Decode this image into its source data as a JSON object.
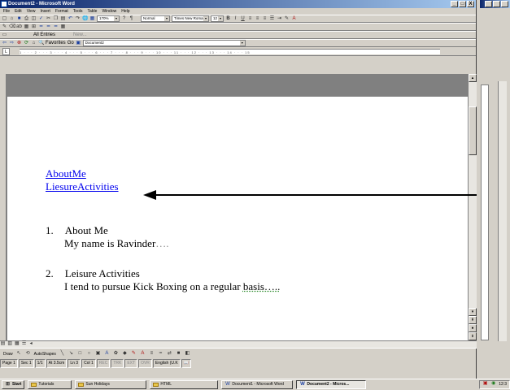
{
  "window": {
    "title": "Document2 - Microsoft Word",
    "buttons": [
      "_",
      "□",
      "X"
    ]
  },
  "menu": [
    "File",
    "Edit",
    "View",
    "Insert",
    "Format",
    "Tools",
    "Table",
    "Window",
    "Help"
  ],
  "toolbar": {
    "zoom": "170%",
    "style": "Normal",
    "font": "Times New Roman",
    "size": "12",
    "autotext": "All Entries",
    "new_label": "New...",
    "favorites": "Favorites",
    "go": "Go",
    "address": "Document2"
  },
  "ruler": {
    "numbers": "1 · · · 2 · · · 3 · · · 4 · · · 5 · · · 6 · · · 7 · · · 8 · · · 9 · · · 10 · · · 11 · · · 12 · · · 13 · · · 14 · · · 15"
  },
  "document": {
    "links": [
      "AboutMe",
      "LiesureActivities"
    ],
    "list": [
      {
        "num": "1.",
        "heading": "About Me",
        "body": "My name is Ravinder",
        "trail": "…."
      },
      {
        "num": "2.",
        "heading": "Leisure Activities",
        "body": "I tend to pursue Kick Boxing on a regular ",
        "underlined": "basis",
        "trail": "….."
      }
    ]
  },
  "drawing": {
    "draw": "Draw",
    "autoshapes": "AutoShapes"
  },
  "status": {
    "page": "Page 1",
    "sec": "Sec 1",
    "pages": "1/1",
    "at": "At 3.5cm",
    "ln": "Ln 3",
    "col": "Col 1",
    "rec": "REC",
    "trk": "TRK",
    "ext": "EXT",
    "ovr": "OVR",
    "lang": "English (U.K"
  },
  "taskbar": {
    "start": "Start",
    "items": [
      "Tutorials",
      "Sun Holidays",
      "HTML",
      "Document1 - Microsoft Word",
      "Document2 - Micros..."
    ],
    "active_index": 4,
    "clock": "12:3"
  }
}
